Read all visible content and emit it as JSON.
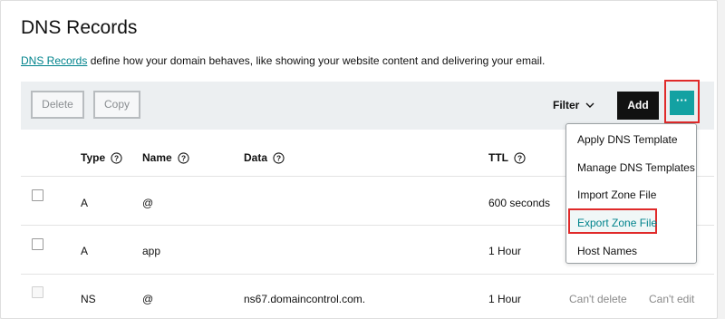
{
  "page": {
    "title": "DNS Records",
    "intro_link": "DNS Records",
    "intro_text": " define how your domain behaves, like showing your website content and delivering your email."
  },
  "toolbar": {
    "delete_label": "Delete",
    "copy_label": "Copy",
    "filter_label": "Filter",
    "add_label": "Add",
    "more_label": "···"
  },
  "table": {
    "headers": {
      "type": "Type",
      "name": "Name",
      "data": "Data",
      "ttl": "TTL"
    },
    "rows": [
      {
        "type": "A",
        "name": "@",
        "data": "",
        "ttl": "600 seconds"
      },
      {
        "type": "A",
        "name": "app",
        "data": "",
        "ttl": "1 Hour"
      },
      {
        "type": "NS",
        "name": "@",
        "data": "ns67.domaincontrol.com.",
        "ttl": "1 Hour",
        "delete_status": "Can't delete",
        "edit_status": "Can't edit"
      }
    ]
  },
  "menu": {
    "items": [
      "Apply DNS Template",
      "Manage DNS Templates",
      "Import Zone File",
      "Export Zone File",
      "Host Names"
    ]
  },
  "colors": {
    "accent": "#13a1a2",
    "link": "#00838c",
    "highlight_box": "#e02a2a",
    "add_button": "#111111"
  }
}
